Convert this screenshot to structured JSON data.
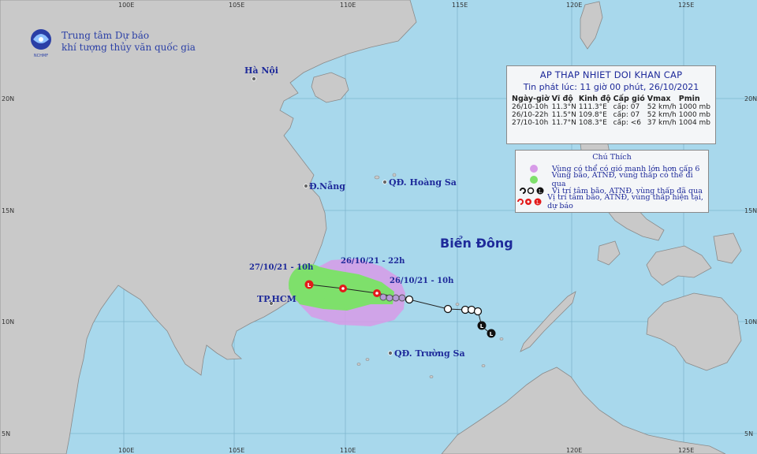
{
  "agency": {
    "line1": "Trung tâm Dự báo",
    "line2": "khí tượng thủy văn quốc gia",
    "logo_caption": "NCHMF"
  },
  "map": {
    "lon_ticks": [
      "100E",
      "105E",
      "110E",
      "115E",
      "120E",
      "125E"
    ],
    "lat_ticks": [
      "20N",
      "15N",
      "10N",
      "5N"
    ],
    "sea_label": "Biển Đông",
    "places": {
      "hanoi": "Hà Nội",
      "danang": "Đ.Nẵng",
      "hcm": "TP.HCM",
      "hoangsa": "QĐ. Hoàng Sa",
      "truongsa": "QĐ. Trường Sa"
    },
    "track_labels": {
      "t1": "26/10/21 - 10h",
      "t2": "26/10/21 - 22h",
      "t3": "27/10/21 - 10h"
    }
  },
  "info": {
    "title": "AP THAP NHIET DOI KHAN CAP",
    "issued": "Tin phát lúc: 11 giờ 00 phút, 26/10/2021",
    "columns": [
      "Ngày-giờ",
      "Vĩ độ",
      "Kinh độ",
      "Cấp gió",
      "Vmax",
      "Pmin"
    ],
    "rows": [
      [
        "26/10-10h",
        "11.3°N",
        "111.3°E",
        "cấp: 07",
        "52 km/h",
        "1000 mb"
      ],
      [
        "26/10-22h",
        "11.5°N",
        "109.8°E",
        "cấp: 07",
        "52 km/h",
        "1000 mb"
      ],
      [
        "27/10-10h",
        "11.7°N",
        "108.3°E",
        "cấp: <6",
        "37 km/h",
        "1004 mb"
      ]
    ]
  },
  "legend": {
    "title": "Chú Thích",
    "items": [
      "Vùng có thể có gió mạnh lớn hơn cấp 6",
      "Vùng bão, ATNĐ, vùng thấp có thể đi qua",
      "Vị trí tâm bão, ATNĐ, vùng thấp đã qua",
      "Vị trí tâm bão, ATNĐ, vùng thấp hiện tại, dự báo"
    ],
    "colors": {
      "wind_zone": "#d79be8",
      "storm_zone": "#7ee06b",
      "past_center": "#111111",
      "forecast_center": "#e31a1a"
    }
  }
}
